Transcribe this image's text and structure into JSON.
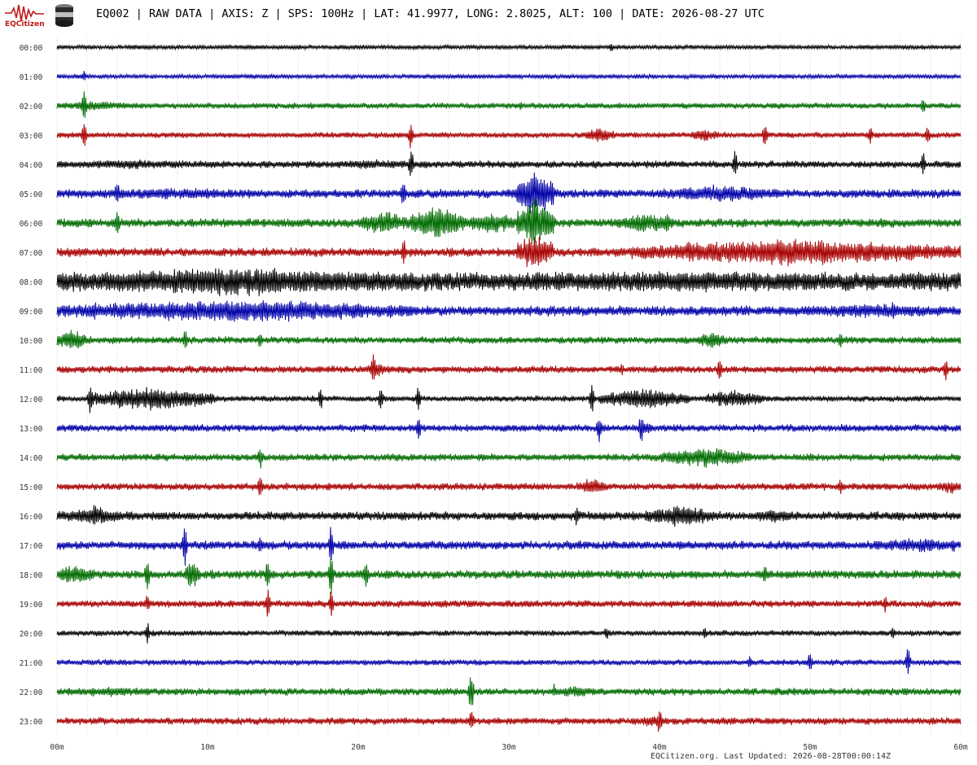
{
  "header": {
    "title": "EQ002 | RAW DATA | AXIS: Z | SPS: 100Hz | LAT: 41.9977, LONG: 2.8025, ALT: 100 | DATE: 2026-08-27 UTC",
    "logo_text": "EQCitizen"
  },
  "footer": {
    "text": "EQCitizen.org. Last Updated: 2026-08-28T00:00:14Z"
  },
  "icons": [
    "seismograph-logo-icon",
    "sensor-canister-icon"
  ],
  "colors": {
    "trace_cycle": [
      "#000000",
      "#0000a8",
      "#006b00",
      "#a80000"
    ],
    "grid": "#d6d6d6",
    "label": "#333333",
    "logo": "#c01818"
  },
  "chart_data": {
    "type": "line",
    "title": "EQ002 | RAW DATA | AXIS: Z | SPS: 100Hz | LAT: 41.9977, LONG: 2.8025, ALT: 100 | DATE: 2026-08-27 UTC",
    "x_tick_labels": [
      "00m",
      "10m",
      "20m",
      "30m",
      "40m",
      "50m",
      "60m"
    ],
    "x_range_minutes": [
      0,
      60
    ],
    "rows": [
      {
        "label": "00:00",
        "base": 3,
        "bursts": [],
        "spikes": [
          [
            36.8,
            8
          ]
        ]
      },
      {
        "label": "01:00",
        "base": 3,
        "bursts": [],
        "spikes": [
          [
            1.8,
            8
          ]
        ]
      },
      {
        "label": "02:00",
        "base": 4,
        "bursts": [
          [
            0,
            5,
            7
          ]
        ],
        "spikes": [
          [
            1.8,
            30
          ],
          [
            30.8,
            7
          ],
          [
            57.5,
            14
          ]
        ]
      },
      {
        "label": "03:00",
        "base": 4,
        "bursts": [
          [
            35,
            37,
            10
          ],
          [
            42,
            44,
            8
          ]
        ],
        "spikes": [
          [
            1.8,
            26
          ],
          [
            23.5,
            22
          ],
          [
            47,
            20
          ],
          [
            54,
            16
          ],
          [
            57.8,
            14
          ]
        ]
      },
      {
        "label": "04:00",
        "base": 5,
        "bursts": [
          [
            0,
            10,
            7
          ],
          [
            18,
            24,
            7
          ]
        ],
        "spikes": [
          [
            23.5,
            26
          ],
          [
            45,
            22
          ],
          [
            57.5,
            18
          ]
        ]
      },
      {
        "label": "05:00",
        "base": 6,
        "bursts": [
          [
            0,
            15,
            8
          ],
          [
            30.5,
            33,
            30
          ],
          [
            40,
            48,
            12
          ]
        ],
        "spikes": [
          [
            23,
            22
          ],
          [
            4,
            20
          ]
        ]
      },
      {
        "label": "06:00",
        "base": 6,
        "bursts": [
          [
            20,
            23.5,
            16
          ],
          [
            23.5,
            27,
            24
          ],
          [
            27,
            31,
            14
          ],
          [
            30.5,
            33,
            34
          ],
          [
            37,
            41,
            14
          ]
        ],
        "spikes": [
          [
            4,
            26
          ],
          [
            40.5,
            24
          ]
        ]
      },
      {
        "label": "07:00",
        "base": 6,
        "bursts": [
          [
            30.5,
            33,
            24
          ],
          [
            38,
            60,
            18
          ]
        ],
        "spikes": [
          [
            23,
            22
          ],
          [
            42,
            20
          ]
        ]
      },
      {
        "label": "08:00",
        "base": 13,
        "bursts": [
          [
            0,
            24,
            20
          ],
          [
            24,
            60,
            14
          ]
        ],
        "spikes": [
          [
            30,
            14
          ],
          [
            46,
            14
          ]
        ]
      },
      {
        "label": "09:00",
        "base": 7,
        "bursts": [
          [
            0,
            24,
            16
          ],
          [
            48,
            60,
            10
          ]
        ],
        "spikes": [
          [
            2.5,
            18
          ],
          [
            55.5,
            16
          ]
        ]
      },
      {
        "label": "10:00",
        "base": 5,
        "bursts": [
          [
            0,
            2,
            16
          ],
          [
            42.5,
            44.5,
            12
          ]
        ],
        "spikes": [
          [
            8.5,
            18
          ],
          [
            13.5,
            14
          ],
          [
            52,
            12
          ]
        ]
      },
      {
        "label": "11:00",
        "base": 5,
        "bursts": [
          [
            20.5,
            22,
            10
          ]
        ],
        "spikes": [
          [
            21,
            26
          ],
          [
            44,
            18
          ],
          [
            59,
            16
          ],
          [
            37.5,
            10
          ]
        ]
      },
      {
        "label": "12:00",
        "base": 4,
        "bursts": [
          [
            2,
            10.5,
            16
          ],
          [
            36,
            42,
            14
          ],
          [
            43,
            47,
            12
          ]
        ],
        "spikes": [
          [
            2.2,
            22
          ],
          [
            17.5,
            16
          ],
          [
            21.5,
            20
          ],
          [
            24,
            18
          ],
          [
            35.5,
            26
          ],
          [
            38.5,
            18
          ],
          [
            44,
            16
          ]
        ]
      },
      {
        "label": "13:00",
        "base": 5,
        "bursts": [
          [
            38.5,
            39.5,
            10
          ]
        ],
        "spikes": [
          [
            24,
            18
          ],
          [
            36,
            22
          ],
          [
            38.8,
            24
          ]
        ]
      },
      {
        "label": "14:00",
        "base": 5,
        "bursts": [
          [
            40,
            46,
            14
          ]
        ],
        "spikes": [
          [
            13.5,
            18
          ]
        ]
      },
      {
        "label": "15:00",
        "base": 5,
        "bursts": [
          [
            34.5,
            36.5,
            12
          ],
          [
            58.5,
            60,
            10
          ]
        ],
        "spikes": [
          [
            13.5,
            18
          ],
          [
            52,
            12
          ]
        ]
      },
      {
        "label": "16:00",
        "base": 6,
        "bursts": [
          [
            0,
            5,
            12
          ],
          [
            39,
            44,
            14
          ],
          [
            46,
            49,
            10
          ]
        ],
        "spikes": [
          [
            2.5,
            20
          ],
          [
            34.5,
            18
          ],
          [
            41,
            22
          ]
        ]
      },
      {
        "label": "17:00",
        "base": 6,
        "bursts": [
          [
            54,
            60,
            10
          ]
        ],
        "spikes": [
          [
            8.5,
            28
          ],
          [
            18.2,
            30
          ],
          [
            13.5,
            16
          ],
          [
            59.5,
            14
          ]
        ]
      },
      {
        "label": "18:00",
        "base": 6,
        "bursts": [
          [
            0,
            2.5,
            14
          ],
          [
            8.5,
            9.5,
            18
          ]
        ],
        "spikes": [
          [
            6,
            26
          ],
          [
            8.8,
            30
          ],
          [
            18.2,
            34
          ],
          [
            14,
            28
          ],
          [
            20.5,
            24
          ],
          [
            47,
            14
          ]
        ]
      },
      {
        "label": "19:00",
        "base": 5,
        "bursts": [],
        "spikes": [
          [
            14,
            22
          ],
          [
            18.2,
            20
          ],
          [
            6,
            14
          ],
          [
            55,
            12
          ]
        ]
      },
      {
        "label": "20:00",
        "base": 4,
        "bursts": [],
        "spikes": [
          [
            36.5,
            12
          ],
          [
            6,
            16
          ],
          [
            43,
            10
          ],
          [
            55.5,
            10
          ]
        ]
      },
      {
        "label": "21:00",
        "base": 4,
        "bursts": [],
        "spikes": [
          [
            50,
            18
          ],
          [
            56.5,
            24
          ],
          [
            46,
            10
          ]
        ]
      },
      {
        "label": "22:00",
        "base": 5,
        "bursts": [
          [
            0,
            7,
            7
          ],
          [
            33,
            36,
            8
          ]
        ],
        "spikes": [
          [
            27.5,
            30
          ],
          [
            33,
            12
          ]
        ]
      },
      {
        "label": "23:00",
        "base": 5,
        "bursts": [
          [
            38.5,
            40.5,
            8
          ]
        ],
        "spikes": [
          [
            40,
            22
          ],
          [
            27.5,
            18
          ]
        ]
      }
    ]
  }
}
